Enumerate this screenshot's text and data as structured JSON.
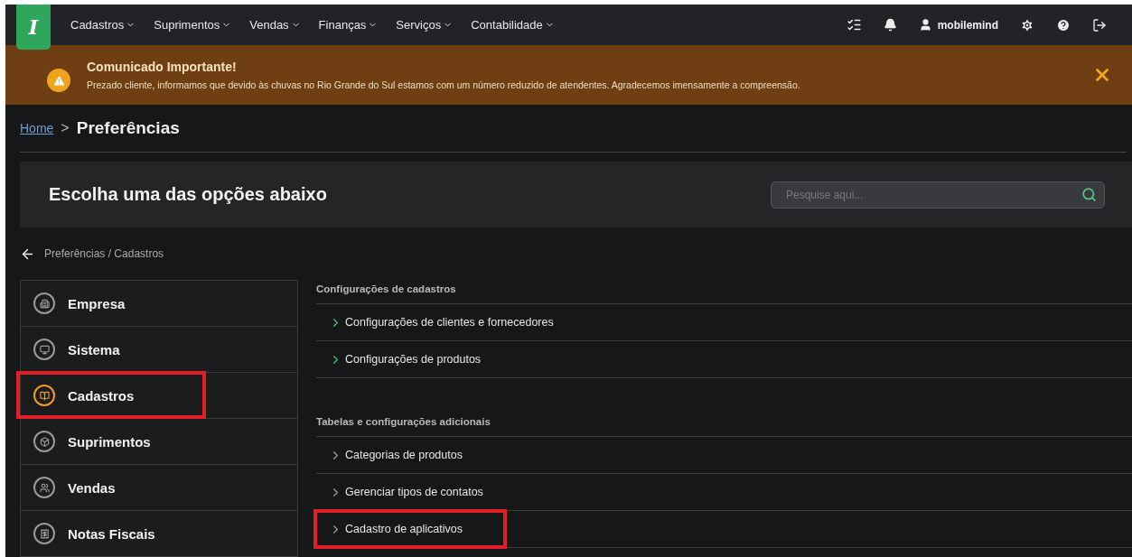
{
  "navbar": {
    "logo": "I",
    "menu": [
      {
        "label": "Cadastros"
      },
      {
        "label": "Suprimentos"
      },
      {
        "label": "Vendas"
      },
      {
        "label": "Finanças"
      },
      {
        "label": "Serviços"
      },
      {
        "label": "Contabilidade"
      }
    ],
    "user": "mobilemind"
  },
  "notice": {
    "title": "Comunicado Importante!",
    "message": "Prezado cliente, informamos que devido às chuvas no Rio Grande do Sul estamos com um número reduzido de atendentes. Agradecemos imensamente a compreensão."
  },
  "breadcrumb": {
    "home": "Home",
    "separator": ">",
    "current": "Preferências"
  },
  "header": {
    "title": "Escolha uma das opções abaixo",
    "search": {
      "placeholder": "Pesquise aqui..."
    }
  },
  "path": "Preferências / Cadastros",
  "sidebar": {
    "items": [
      {
        "label": "Empresa",
        "selected": false,
        "highlighted": false
      },
      {
        "label": "Sistema",
        "selected": false,
        "highlighted": false
      },
      {
        "label": "Cadastros",
        "selected": true,
        "highlighted": true
      },
      {
        "label": "Suprimentos",
        "selected": false,
        "highlighted": false
      },
      {
        "label": "Vendas",
        "selected": false,
        "highlighted": false
      },
      {
        "label": "Notas Fiscais",
        "selected": false,
        "highlighted": false
      }
    ]
  },
  "sections": [
    {
      "title": "Configurações de cadastros",
      "accent": true,
      "links": [
        {
          "label": "Configurações de clientes e fornecedores",
          "highlighted": false
        },
        {
          "label": "Configurações de produtos",
          "highlighted": false
        }
      ]
    },
    {
      "title": "Tabelas e configurações adicionais",
      "accent": false,
      "links": [
        {
          "label": "Categorias de produtos",
          "highlighted": false
        },
        {
          "label": "Gerenciar tipos de contatos",
          "highlighted": false
        },
        {
          "label": "Cadastro de aplicativos",
          "highlighted": true
        }
      ]
    }
  ]
}
